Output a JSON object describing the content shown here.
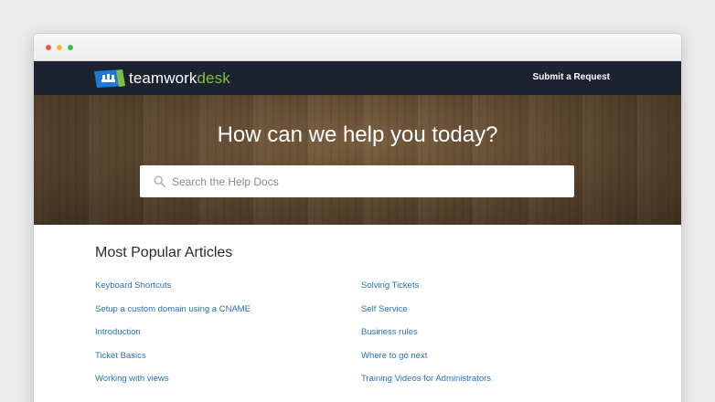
{
  "window": {
    "controls": [
      "close",
      "minimize",
      "zoom"
    ]
  },
  "navbar": {
    "logo": {
      "word_team": "teamwork",
      "word_desk": "desk",
      "icon": "teamwork-logo-icon"
    },
    "submit_label": "Submit a Request"
  },
  "hero": {
    "title": "How can we help you today?",
    "search": {
      "placeholder": "Search the Help Docs",
      "value": "",
      "icon": "search-icon"
    }
  },
  "popular": {
    "title": "Most Popular Articles",
    "left": [
      "Keyboard Shortcuts",
      "Setup a custom domain using a CNAME",
      "Introduction",
      "Ticket Basics",
      "Working with views"
    ],
    "right": [
      "Solving Tickets",
      "Self Service",
      "Business rules",
      "Where to go next",
      "Training Videos for Administrators"
    ]
  },
  "colors": {
    "navbar_bg": "#1c2230",
    "link": "#2b71b5",
    "logo_accent_green": "#7ac142",
    "logo_blue": "#1f78d1"
  }
}
